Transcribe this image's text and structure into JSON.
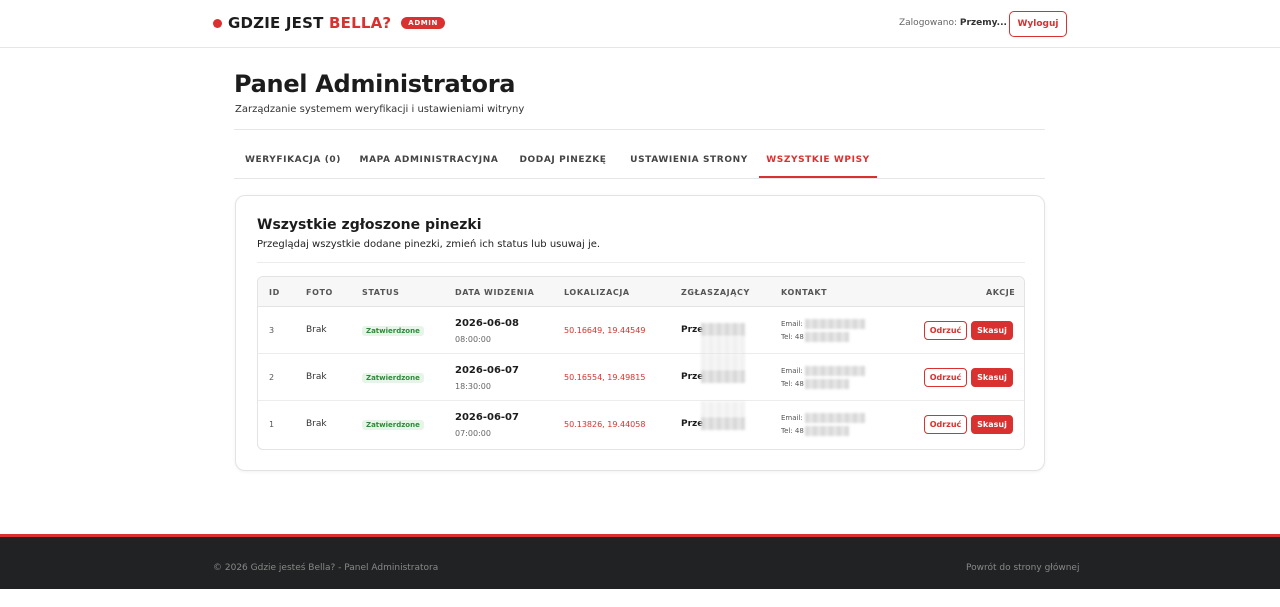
{
  "header": {
    "brand_main": "GDZIE JEST ",
    "brand_accent": "BELLA?",
    "badge": "ADMIN",
    "logged_in_label": "Zalogowano: ",
    "logged_in_user": "Przemy...",
    "logout_label": "Wyloguj",
    "accent_color": "#d9312f"
  },
  "page": {
    "title": "Panel Administratora",
    "subtitle": "Zarządzanie systemem weryfikacji i ustawieniami witryny"
  },
  "tabs": [
    {
      "label": "WERYFIKACJA (0)",
      "active": false
    },
    {
      "label": "MAPA ADMINISTRACYJNA",
      "active": false
    },
    {
      "label": "DODAJ PINEZKĘ",
      "active": false
    },
    {
      "label": "USTAWIENIA STRONY",
      "active": false
    },
    {
      "label": "WSZYSTKIE WPISY",
      "active": true
    }
  ],
  "card": {
    "title": "Wszystkie zgłoszone pinezki",
    "subtitle": "Przeglądaj wszystkie dodane pinezki, zmień ich status lub usuwaj je."
  },
  "table": {
    "columns": [
      "ID",
      "FOTO",
      "STATUS",
      "DATA WIDZENIA",
      "LOKALIZACJA",
      "ZGŁASZAJĄCY",
      "KONTAKT",
      "AKCJE"
    ],
    "rows": [
      {
        "id": "3",
        "photo": "Brak",
        "status": "Zatwierdzone",
        "date": "2026-06-08",
        "time": "08:00:00",
        "location": "50.16649, 19.44549",
        "reporter": "Prze",
        "email_label": "Email:",
        "tel_label": "Tel: 48",
        "reject": "Odrzuć",
        "delete": "Skasuj"
      },
      {
        "id": "2",
        "photo": "Brak",
        "status": "Zatwierdzone",
        "date": "2026-06-07",
        "time": "18:30:00",
        "location": "50.16554, 19.49815",
        "reporter": "Prze",
        "email_label": "Email:",
        "tel_label": "Tel: 48",
        "reject": "Odrzuć",
        "delete": "Skasuj"
      },
      {
        "id": "1",
        "photo": "Brak",
        "status": "Zatwierdzone",
        "date": "2026-06-07",
        "time": "07:00:00",
        "location": "50.13826, 19.44058",
        "reporter": "Prze",
        "email_label": "Email:",
        "tel_label": "Tel: 48",
        "reject": "Odrzuć",
        "delete": "Skasuj"
      }
    ]
  },
  "footer": {
    "copyright": "© 2026 Gdzie jesteś Bella? - Panel Administratora",
    "back_link": "Powrót do strony głównej"
  }
}
